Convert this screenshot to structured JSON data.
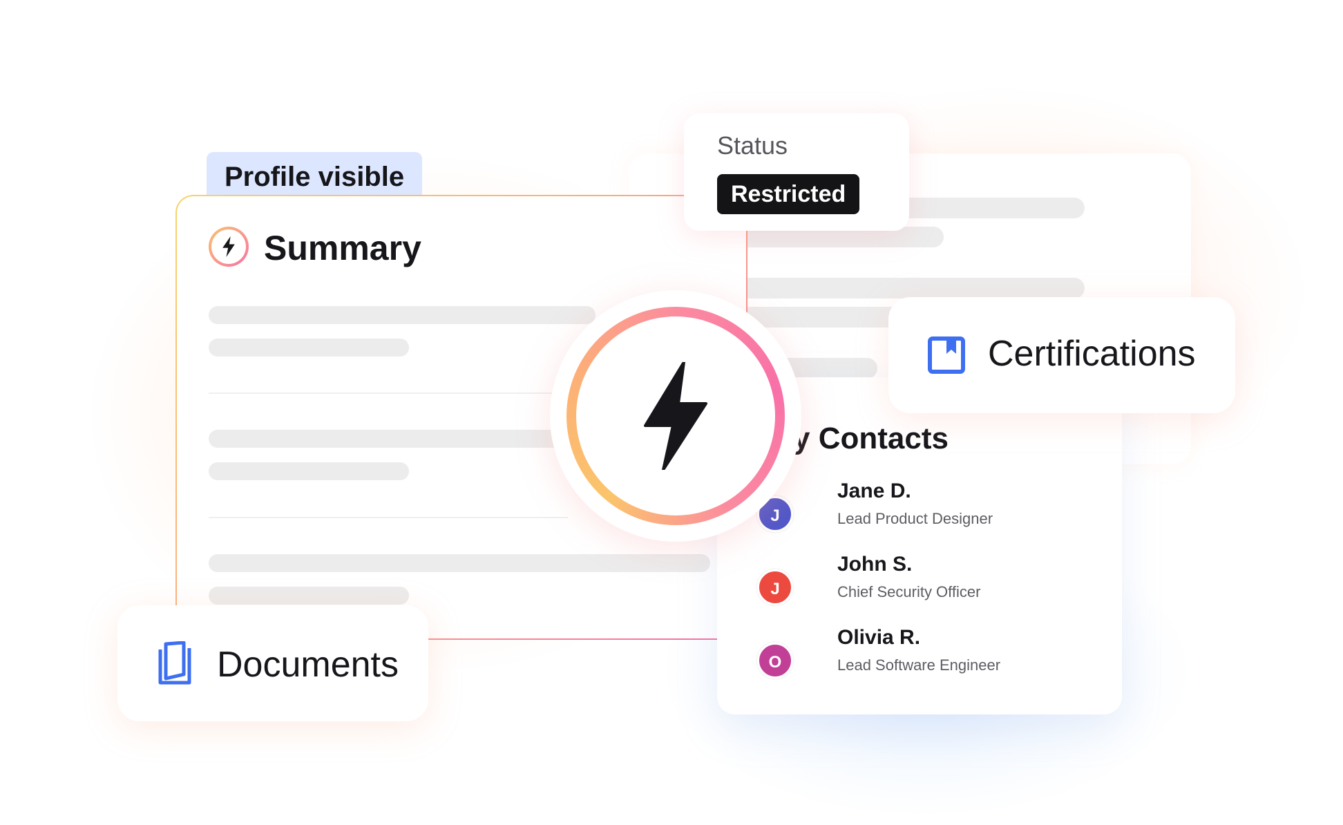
{
  "profile_badge": "Profile visible",
  "summary": {
    "title": "Summary",
    "icon": "bolt-icon"
  },
  "status": {
    "label": "Status",
    "value": "Restricted"
  },
  "certifications": {
    "label": "Certifications",
    "icon": "bookmark-icon"
  },
  "documents": {
    "label": "Documents",
    "icon": "documents-icon"
  },
  "contacts": {
    "title": "y Contacts",
    "items": [
      {
        "initial": "J",
        "name": "Jane D.",
        "role": "Lead Product Designer",
        "color": "#4f57c9"
      },
      {
        "initial": "J",
        "name": "John S.",
        "role": "Chief Security Officer",
        "color": "#ec4a3f"
      },
      {
        "initial": "O",
        "name": "Olivia R.",
        "role": "Lead Software Engineer",
        "color": "#c23f97"
      }
    ]
  },
  "center_icon": "bolt-icon",
  "colors": {
    "accent_blue": "#3d6ff0",
    "dark": "#141416",
    "gradient_start": "#fbc56b",
    "gradient_end": "#f870a8"
  }
}
